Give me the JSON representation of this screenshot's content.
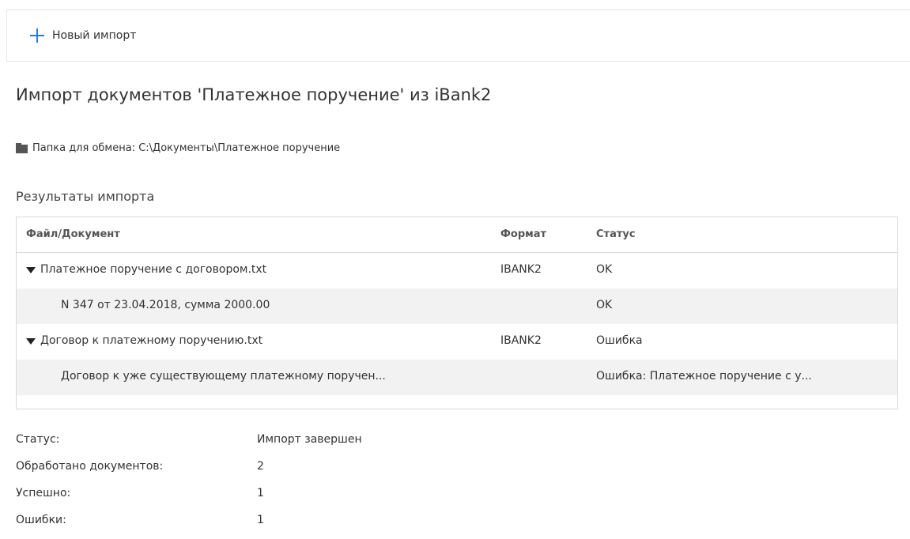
{
  "toolbar": {
    "new_import_label": "Новый импорт"
  },
  "page_title": "Импорт документов 'Платежное поручение' из iBank2",
  "exchange_folder": {
    "label": "Папка для обмена:",
    "path": "C:\\Документы\\Платежное поручение"
  },
  "results": {
    "title": "Результаты импорта",
    "columns": {
      "file": "Файл/Документ",
      "format": "Формат",
      "status": "Статус"
    },
    "rows": [
      {
        "kind": "file",
        "name": "Платежное поручение с договором.txt",
        "format": "IBANK2",
        "status": "OK"
      },
      {
        "kind": "document",
        "name": "N 347 от 23.04.2018, сумма 2000.00",
        "format": "",
        "status": "OK"
      },
      {
        "kind": "file",
        "name": "Договор к платежному поручению.txt",
        "format": "IBANK2",
        "status": "Ошибка"
      },
      {
        "kind": "document",
        "name": "Договор к уже существующему платежному поручен...",
        "format": "",
        "status": "Ошибка: Платежное поручение с у..."
      }
    ]
  },
  "summary": {
    "status_label": "Статус:",
    "status_value": "Импорт завершен",
    "processed_label": "Обработано документов:",
    "processed_value": "2",
    "success_label": "Успешно:",
    "success_value": "1",
    "errors_label": "Ошибки:",
    "errors_value": "1"
  },
  "icons": {
    "new_import": "plus-icon",
    "folder": "folder-icon",
    "expand": "caret-down-icon"
  },
  "colors": {
    "accent": "#2b7bd6",
    "alt_row": "#f2f2f2",
    "border": "#d9d9d9"
  }
}
